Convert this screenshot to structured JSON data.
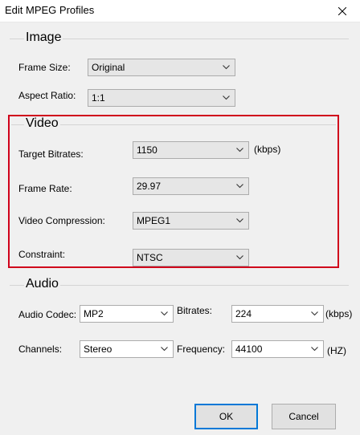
{
  "window": {
    "title": "Edit MPEG Profiles"
  },
  "image": {
    "group_label": "Image",
    "frame_size_label": "Frame Size:",
    "frame_size_value": "Original",
    "aspect_ratio_label": "Aspect Ratio:",
    "aspect_ratio_value": "1:1"
  },
  "video": {
    "group_label": "Video",
    "target_bitrates_label": "Target Bitrates:",
    "target_bitrates_value": "1150",
    "target_bitrates_unit": "(kbps)",
    "frame_rate_label": "Frame Rate:",
    "frame_rate_value": "29.97",
    "compression_label": "Video Compression:",
    "compression_value": "MPEG1",
    "constraint_label": "Constraint:",
    "constraint_value": "NTSC"
  },
  "audio": {
    "group_label": "Audio",
    "codec_label": "Audio Codec:",
    "codec_value": "MP2",
    "bitrates_label": "Bitrates:",
    "bitrates_value": "224",
    "bitrates_unit": "(kbps)",
    "channels_label": "Channels:",
    "channels_value": "Stereo",
    "frequency_label": "Frequency:",
    "frequency_value": "44100",
    "frequency_unit": "(HZ)"
  },
  "buttons": {
    "ok_label": "OK",
    "cancel_label": "Cancel"
  },
  "colors": {
    "highlight_border": "#d0021b",
    "default_button_border": "#0078d7"
  }
}
